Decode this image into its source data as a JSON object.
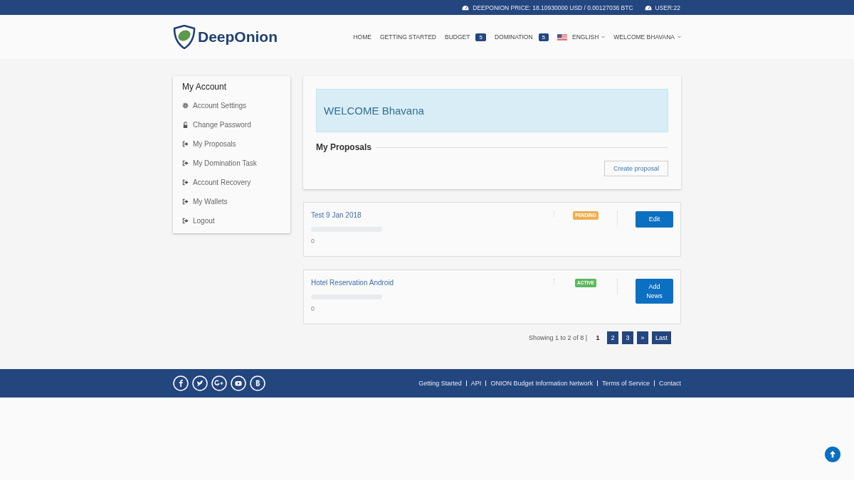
{
  "topbar": {
    "price": "DEEPONION PRICE: 18.10930000 USD / 0.00127036 BTC",
    "users": "USER:22"
  },
  "logo": {
    "text": "DeepOnion"
  },
  "nav": [
    {
      "label": "HOME",
      "dropdown": false,
      "flag": false
    },
    {
      "label": "GETTING STARTED",
      "dropdown": false,
      "flag": false
    },
    {
      "label": "BUDGET",
      "badge": "5",
      "dropdown": false,
      "flag": false
    },
    {
      "label": "DOMINATION",
      "badge": "5",
      "dropdown": false,
      "flag": false
    },
    {
      "label": "ENGLISH",
      "dropdown": true,
      "flag": true
    },
    {
      "label": "WELCOME BHAVANA",
      "dropdown": true,
      "flag": false
    }
  ],
  "sidebar": {
    "title": "My Account",
    "items": [
      {
        "label": "Account Settings",
        "kind": "gear"
      },
      {
        "label": "Change Password",
        "kind": "lock"
      },
      {
        "label": "My Proposals",
        "kind": "link"
      },
      {
        "label": "My Domination Task",
        "kind": "link"
      },
      {
        "label": "Account Recovery",
        "kind": "link"
      },
      {
        "label": "My Wallets",
        "kind": "link"
      },
      {
        "label": "Logout",
        "kind": "link"
      }
    ]
  },
  "welcome": "WELCOME Bhavana",
  "section_title": "My Proposals",
  "create_button": "Create proposal",
  "proposals": [
    {
      "title": "Test 9 Jan 2018",
      "level": 0,
      "count": "0",
      "status": "PENDING",
      "kind": "pending",
      "button": "Edit"
    },
    {
      "title": "Hotel Reservation Android",
      "level": 0,
      "count": "0",
      "status": "ACTIVE",
      "kind": "active",
      "button": "Add News"
    }
  ],
  "pagination": {
    "summary": "Showing 1 to 2 of 8 |",
    "pages": [
      {
        "label": "1",
        "selected": true
      },
      {
        "label": "2",
        "selected": false
      },
      {
        "label": "3",
        "selected": false
      },
      {
        "label": "»",
        "selected": false
      },
      {
        "label": "Last",
        "selected": false
      }
    ]
  },
  "footer": {
    "social": [
      {
        "kind": "facebook"
      },
      {
        "kind": "twitter"
      },
      {
        "kind": "google-plus"
      },
      {
        "kind": "youtube"
      },
      {
        "kind": "bitcoin"
      }
    ],
    "links": [
      "Getting Started",
      "API",
      "ONION Budget Information Network",
      "Terms of Service",
      "Contact"
    ]
  }
}
